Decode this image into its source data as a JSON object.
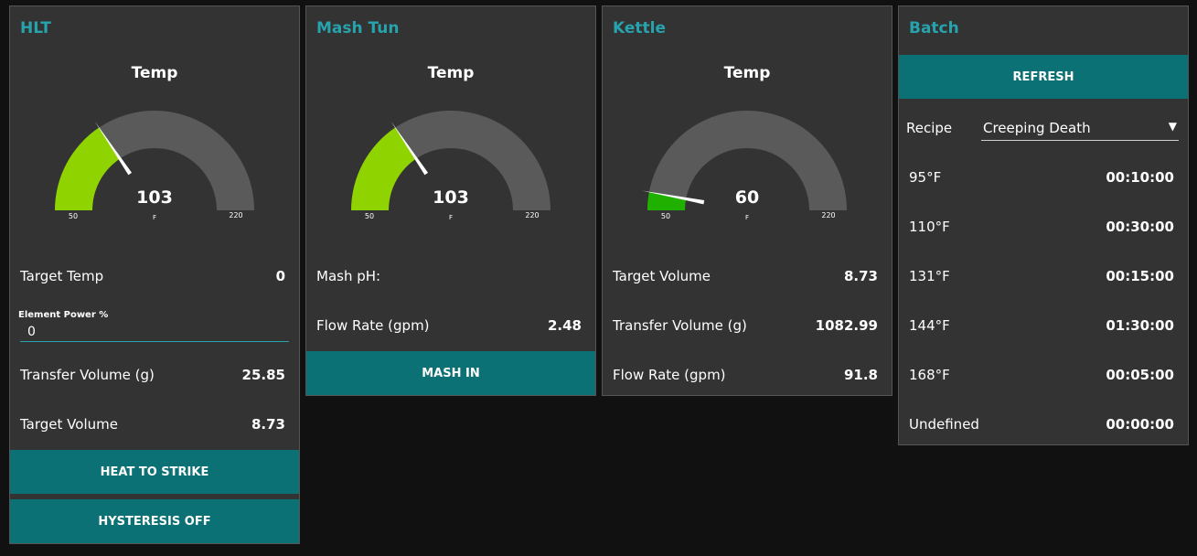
{
  "hlt": {
    "title": "HLT",
    "gauge": {
      "label": "Temp",
      "value": "103",
      "unit": "F",
      "min": "50",
      "max": "220",
      "min_num": 50,
      "max_num": 220,
      "value_num": 103,
      "color": "#8fd400"
    },
    "target_temp": {
      "label": "Target Temp",
      "value": "0"
    },
    "element_power": {
      "label": "Element Power %",
      "value": "0"
    },
    "transfer_volume": {
      "label": "Transfer Volume (g)",
      "value": "25.85"
    },
    "target_volume": {
      "label": "Target Volume",
      "value": "8.73"
    },
    "heat_button": "HEAT TO STRIKE",
    "hysteresis_button": "HYSTERESIS OFF"
  },
  "mash": {
    "title": "Mash Tun",
    "gauge": {
      "label": "Temp",
      "value": "103",
      "unit": "F",
      "min": "50",
      "max": "220",
      "min_num": 50,
      "max_num": 220,
      "value_num": 103,
      "color": "#8fd400"
    },
    "ph": {
      "label": "Mash pH:",
      "value": ""
    },
    "flow_rate": {
      "label": "Flow Rate (gpm)",
      "value": "2.48"
    },
    "mash_in_button": "MASH IN"
  },
  "kettle": {
    "title": "Kettle",
    "gauge": {
      "label": "Temp",
      "value": "60",
      "unit": "F",
      "min": "50",
      "max": "220",
      "min_num": 50,
      "max_num": 220,
      "value_num": 60,
      "color": "#20b000"
    },
    "target_volume": {
      "label": "Target Volume",
      "value": "8.73"
    },
    "transfer_volume": {
      "label": "Transfer Volume (g)",
      "value": "1082.99"
    },
    "flow_rate": {
      "label": "Flow Rate (gpm)",
      "value": "91.8"
    }
  },
  "batch": {
    "title": "Batch",
    "refresh_button": "REFRESH",
    "recipe_label": "Recipe",
    "recipe_value": "Creeping Death",
    "steps": [
      {
        "temp": "95°F",
        "time": "00:10:00"
      },
      {
        "temp": "110°F",
        "time": "00:30:00"
      },
      {
        "temp": "131°F",
        "time": "00:15:00"
      },
      {
        "temp": "144°F",
        "time": "01:30:00"
      },
      {
        "temp": "168°F",
        "time": "00:05:00"
      },
      {
        "temp": "Undefined",
        "time": "00:00:00"
      }
    ]
  },
  "colors": {
    "accent": "#26a3ad",
    "button": "#0b7174",
    "card": "#333333",
    "background": "#111111",
    "gauge_track": "#5a5a5a"
  }
}
